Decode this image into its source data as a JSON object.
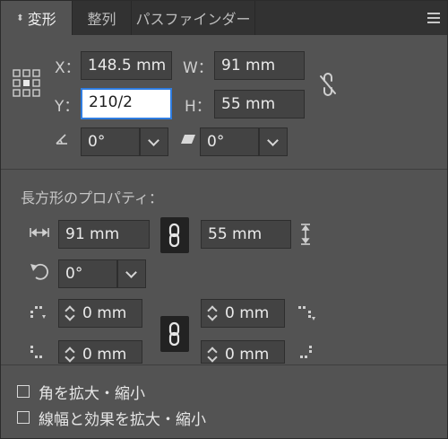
{
  "tabs": [
    {
      "label": "変形",
      "active": true
    },
    {
      "label": "整列",
      "active": false
    },
    {
      "label": "パスファインダー",
      "active": false
    }
  ],
  "transform": {
    "x_label": "X：",
    "x_value": "148.5 mm",
    "y_label": "Y：",
    "y_value": "210/2",
    "w_label": "W：",
    "w_value": "91 mm",
    "h_label": "H：",
    "h_value": "55 mm",
    "rotate_value": "0°",
    "shear_value": "0°"
  },
  "rect_props": {
    "title": "長方形のプロパティ：",
    "width_value": "91 mm",
    "height_value": "55 mm",
    "rotation_value": "0°",
    "corner_tl": "0 mm",
    "corner_tr": "0 mm",
    "corner_bl": "0 mm",
    "corner_br": "0 mm"
  },
  "options": {
    "scale_corners": "角を拡大・縮小",
    "scale_strokes": "線幅と効果を拡大・縮小"
  },
  "colors": {
    "panel_bg": "#535353",
    "tab_bg": "#323232",
    "focus_border": "#2f7de1"
  }
}
